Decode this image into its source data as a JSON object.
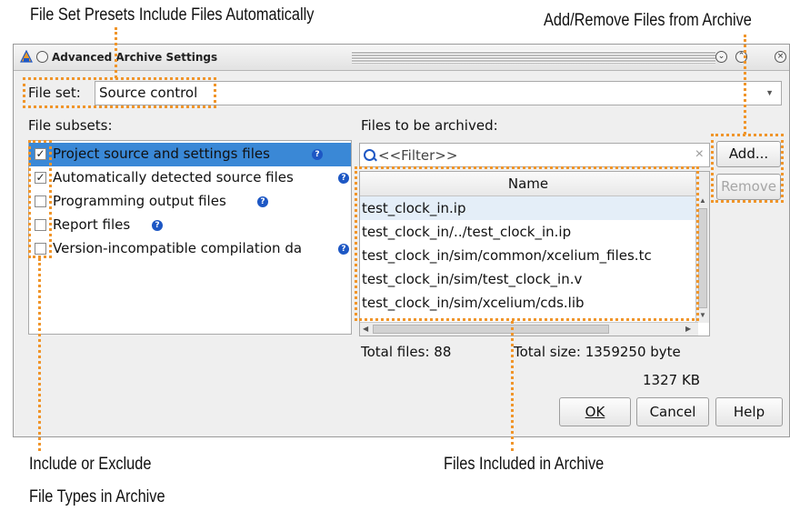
{
  "annotations": {
    "file_set_presets": "File Set Presets Include Files Automatically",
    "add_remove": "Add/Remove Files from Archive",
    "include_exclude_line1": "Include or Exclude",
    "include_exclude_line2": "File Types in Archive",
    "files_included": "Files Included in Archive",
    "accent_color": "#f0952a"
  },
  "window": {
    "title": "Advanced Archive Settings",
    "icon": "quartus-app-icon",
    "controls": [
      "minimize-icon",
      "maximize-icon",
      "close-icon"
    ],
    "close_glyph": "×"
  },
  "file_set": {
    "label": "File set:",
    "value": "Source control"
  },
  "file_subsets": {
    "label": "File subsets:",
    "items": [
      {
        "label": "Project source and settings files",
        "checked": true,
        "selected": true,
        "check": "✓"
      },
      {
        "label": "Automatically detected source files",
        "checked": true,
        "selected": false,
        "check": "✓"
      },
      {
        "label": "Programming output files",
        "checked": false,
        "selected": false,
        "check": ""
      },
      {
        "label": "Report files",
        "checked": false,
        "selected": false,
        "check": ""
      },
      {
        "label": "Version-incompatible compilation da",
        "checked": false,
        "selected": false,
        "check": ""
      }
    ],
    "help_glyph": "?"
  },
  "files_to_archive": {
    "label": "Files to be archived:",
    "filter_placeholder": "<<Filter>>",
    "clear_glyph": "×",
    "column_header": "Name",
    "rows": [
      "test_clock_in.ip",
      "test_clock_in/../test_clock_in.ip",
      "test_clock_in/sim/common/xcelium_files.tc",
      "test_clock_in/sim/test_clock_in.v",
      "test_clock_in/sim/xcelium/cds.lib"
    ]
  },
  "buttons": {
    "add": "Add...",
    "remove": "Remove",
    "ok": "OK",
    "cancel": "Cancel",
    "help": "Help"
  },
  "totals": {
    "total_files": "Total files: 88",
    "total_size": "Total size: 1359250 byte",
    "total_kb": "1327 KB"
  },
  "colors": {
    "selection": "#3a88d6",
    "help_icon": "#1d57c4"
  }
}
